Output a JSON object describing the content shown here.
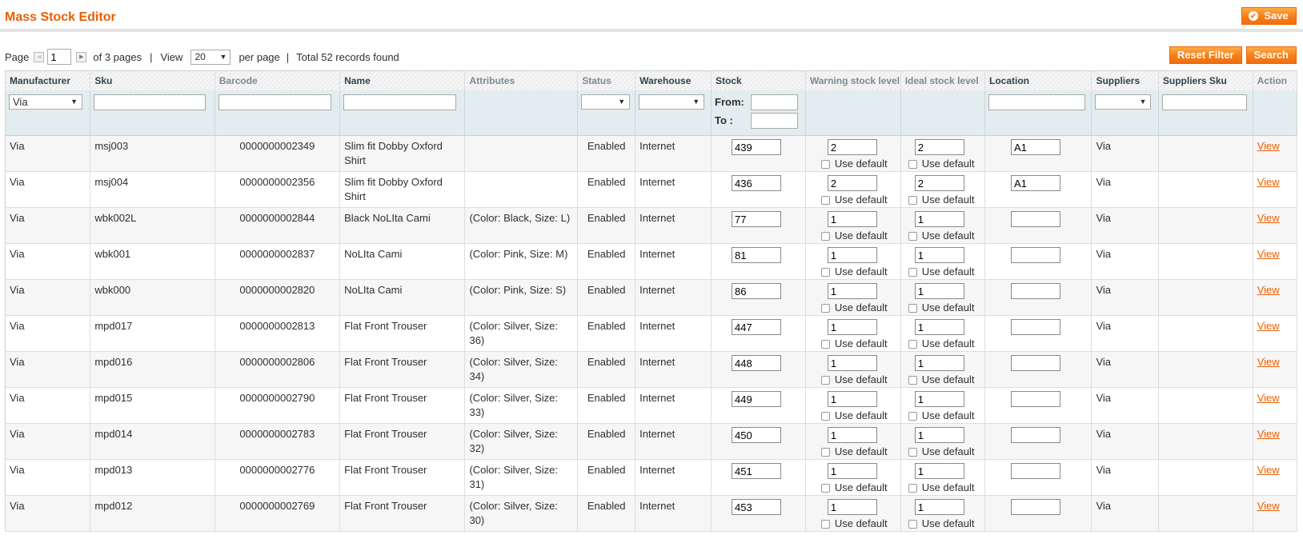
{
  "header": {
    "title": "Mass Stock Editor",
    "save_label": "Save"
  },
  "pager": {
    "page_label": "Page",
    "page_value": "1",
    "of_pages": "of 3 pages",
    "view_label": "View",
    "per_page_value": "20",
    "per_page_label": "per page",
    "total": "Total 52 records found",
    "separator": "|"
  },
  "actions": {
    "reset_filter": "Reset Filter",
    "search": "Search"
  },
  "columns": [
    "Manufacturer",
    "Sku",
    "Barcode",
    "Name",
    "Attributes",
    "Status",
    "Warehouse",
    "Stock",
    "Warning stock level",
    "Ideal stock level",
    "Location",
    "Suppliers",
    "Suppliers Sku",
    "Action"
  ],
  "filters": {
    "manufacturer": "Via",
    "from_label": "From:",
    "to_label": "To :"
  },
  "use_default_label": "Use default",
  "rows": [
    {
      "manufacturer": "Via",
      "sku": "msj003",
      "barcode": "0000000002349",
      "name": "Slim fit Dobby Oxford Shirt",
      "attributes": "",
      "status": "Enabled",
      "warehouse": "Internet",
      "stock": "439",
      "warning": "2",
      "ideal": "2",
      "location": "A1",
      "suppliers": "Via",
      "suppliers_sku": "",
      "action": "View"
    },
    {
      "manufacturer": "Via",
      "sku": "msj004",
      "barcode": "0000000002356",
      "name": "Slim fit Dobby Oxford Shirt",
      "attributes": "",
      "status": "Enabled",
      "warehouse": "Internet",
      "stock": "436",
      "warning": "2",
      "ideal": "2",
      "location": "A1",
      "suppliers": "Via",
      "suppliers_sku": "",
      "action": "View"
    },
    {
      "manufacturer": "Via",
      "sku": "wbk002L",
      "barcode": "0000000002844",
      "name": "Black NoLIta Cami",
      "attributes": "(Color: Black, Size: L)",
      "status": "Enabled",
      "warehouse": "Internet",
      "stock": "77",
      "warning": "1",
      "ideal": "1",
      "location": "",
      "suppliers": "Via",
      "suppliers_sku": "",
      "action": "View"
    },
    {
      "manufacturer": "Via",
      "sku": "wbk001",
      "barcode": "0000000002837",
      "name": "NoLIta Cami",
      "attributes": "(Color: Pink, Size: M)",
      "status": "Enabled",
      "warehouse": "Internet",
      "stock": "81",
      "warning": "1",
      "ideal": "1",
      "location": "",
      "suppliers": "Via",
      "suppliers_sku": "",
      "action": "View"
    },
    {
      "manufacturer": "Via",
      "sku": "wbk000",
      "barcode": "0000000002820",
      "name": "NoLIta Cami",
      "attributes": "(Color: Pink, Size: S)",
      "status": "Enabled",
      "warehouse": "Internet",
      "stock": "86",
      "warning": "1",
      "ideal": "1",
      "location": "",
      "suppliers": "Via",
      "suppliers_sku": "",
      "action": "View"
    },
    {
      "manufacturer": "Via",
      "sku": "mpd017",
      "barcode": "0000000002813",
      "name": "Flat Front Trouser",
      "attributes": "(Color: Silver, Size: 36)",
      "status": "Enabled",
      "warehouse": "Internet",
      "stock": "447",
      "warning": "1",
      "ideal": "1",
      "location": "",
      "suppliers": "Via",
      "suppliers_sku": "",
      "action": "View"
    },
    {
      "manufacturer": "Via",
      "sku": "mpd016",
      "barcode": "0000000002806",
      "name": "Flat Front Trouser",
      "attributes": "(Color: Silver, Size: 34)",
      "status": "Enabled",
      "warehouse": "Internet",
      "stock": "448",
      "warning": "1",
      "ideal": "1",
      "location": "",
      "suppliers": "Via",
      "suppliers_sku": "",
      "action": "View"
    },
    {
      "manufacturer": "Via",
      "sku": "mpd015",
      "barcode": "0000000002790",
      "name": "Flat Front Trouser",
      "attributes": "(Color: Silver, Size: 33)",
      "status": "Enabled",
      "warehouse": "Internet",
      "stock": "449",
      "warning": "1",
      "ideal": "1",
      "location": "",
      "suppliers": "Via",
      "suppliers_sku": "",
      "action": "View"
    },
    {
      "manufacturer": "Via",
      "sku": "mpd014",
      "barcode": "0000000002783",
      "name": "Flat Front Trouser",
      "attributes": "(Color: Silver, Size: 32)",
      "status": "Enabled",
      "warehouse": "Internet",
      "stock": "450",
      "warning": "1",
      "ideal": "1",
      "location": "",
      "suppliers": "Via",
      "suppliers_sku": "",
      "action": "View"
    },
    {
      "manufacturer": "Via",
      "sku": "mpd013",
      "barcode": "0000000002776",
      "name": "Flat Front Trouser",
      "attributes": "(Color: Silver, Size: 31)",
      "status": "Enabled",
      "warehouse": "Internet",
      "stock": "451",
      "warning": "1",
      "ideal": "1",
      "location": "",
      "suppliers": "Via",
      "suppliers_sku": "",
      "action": "View"
    },
    {
      "manufacturer": "Via",
      "sku": "mpd012",
      "barcode": "0000000002769",
      "name": "Flat Front Trouser",
      "attributes": "(Color: Silver, Size: 30)",
      "status": "Enabled",
      "warehouse": "Internet",
      "stock": "453",
      "warning": "1",
      "ideal": "1",
      "location": "",
      "suppliers": "Via",
      "suppliers_sku": "",
      "action": "View"
    }
  ],
  "colors": {
    "accent": "#eb5e00",
    "button": "#f77c16",
    "filter_row": "#e3ecee"
  }
}
